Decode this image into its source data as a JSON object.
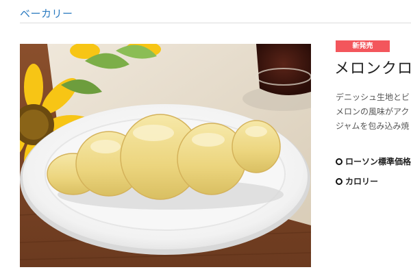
{
  "breadcrumb": {
    "label": "ベーカリー"
  },
  "product": {
    "badge": "新発売",
    "title": "メロンクロ",
    "description_lines": [
      "デニッシュ生地とビ",
      "メロンの風味がアク",
      "ジャムを包み込み焼"
    ],
    "specs": [
      {
        "label": "ローソン標準価格"
      },
      {
        "label": "カロリー"
      }
    ]
  },
  "colors": {
    "breadcrumb_link": "#2a7ac0",
    "badge_bg": "#f3565c",
    "text": "#222222"
  }
}
